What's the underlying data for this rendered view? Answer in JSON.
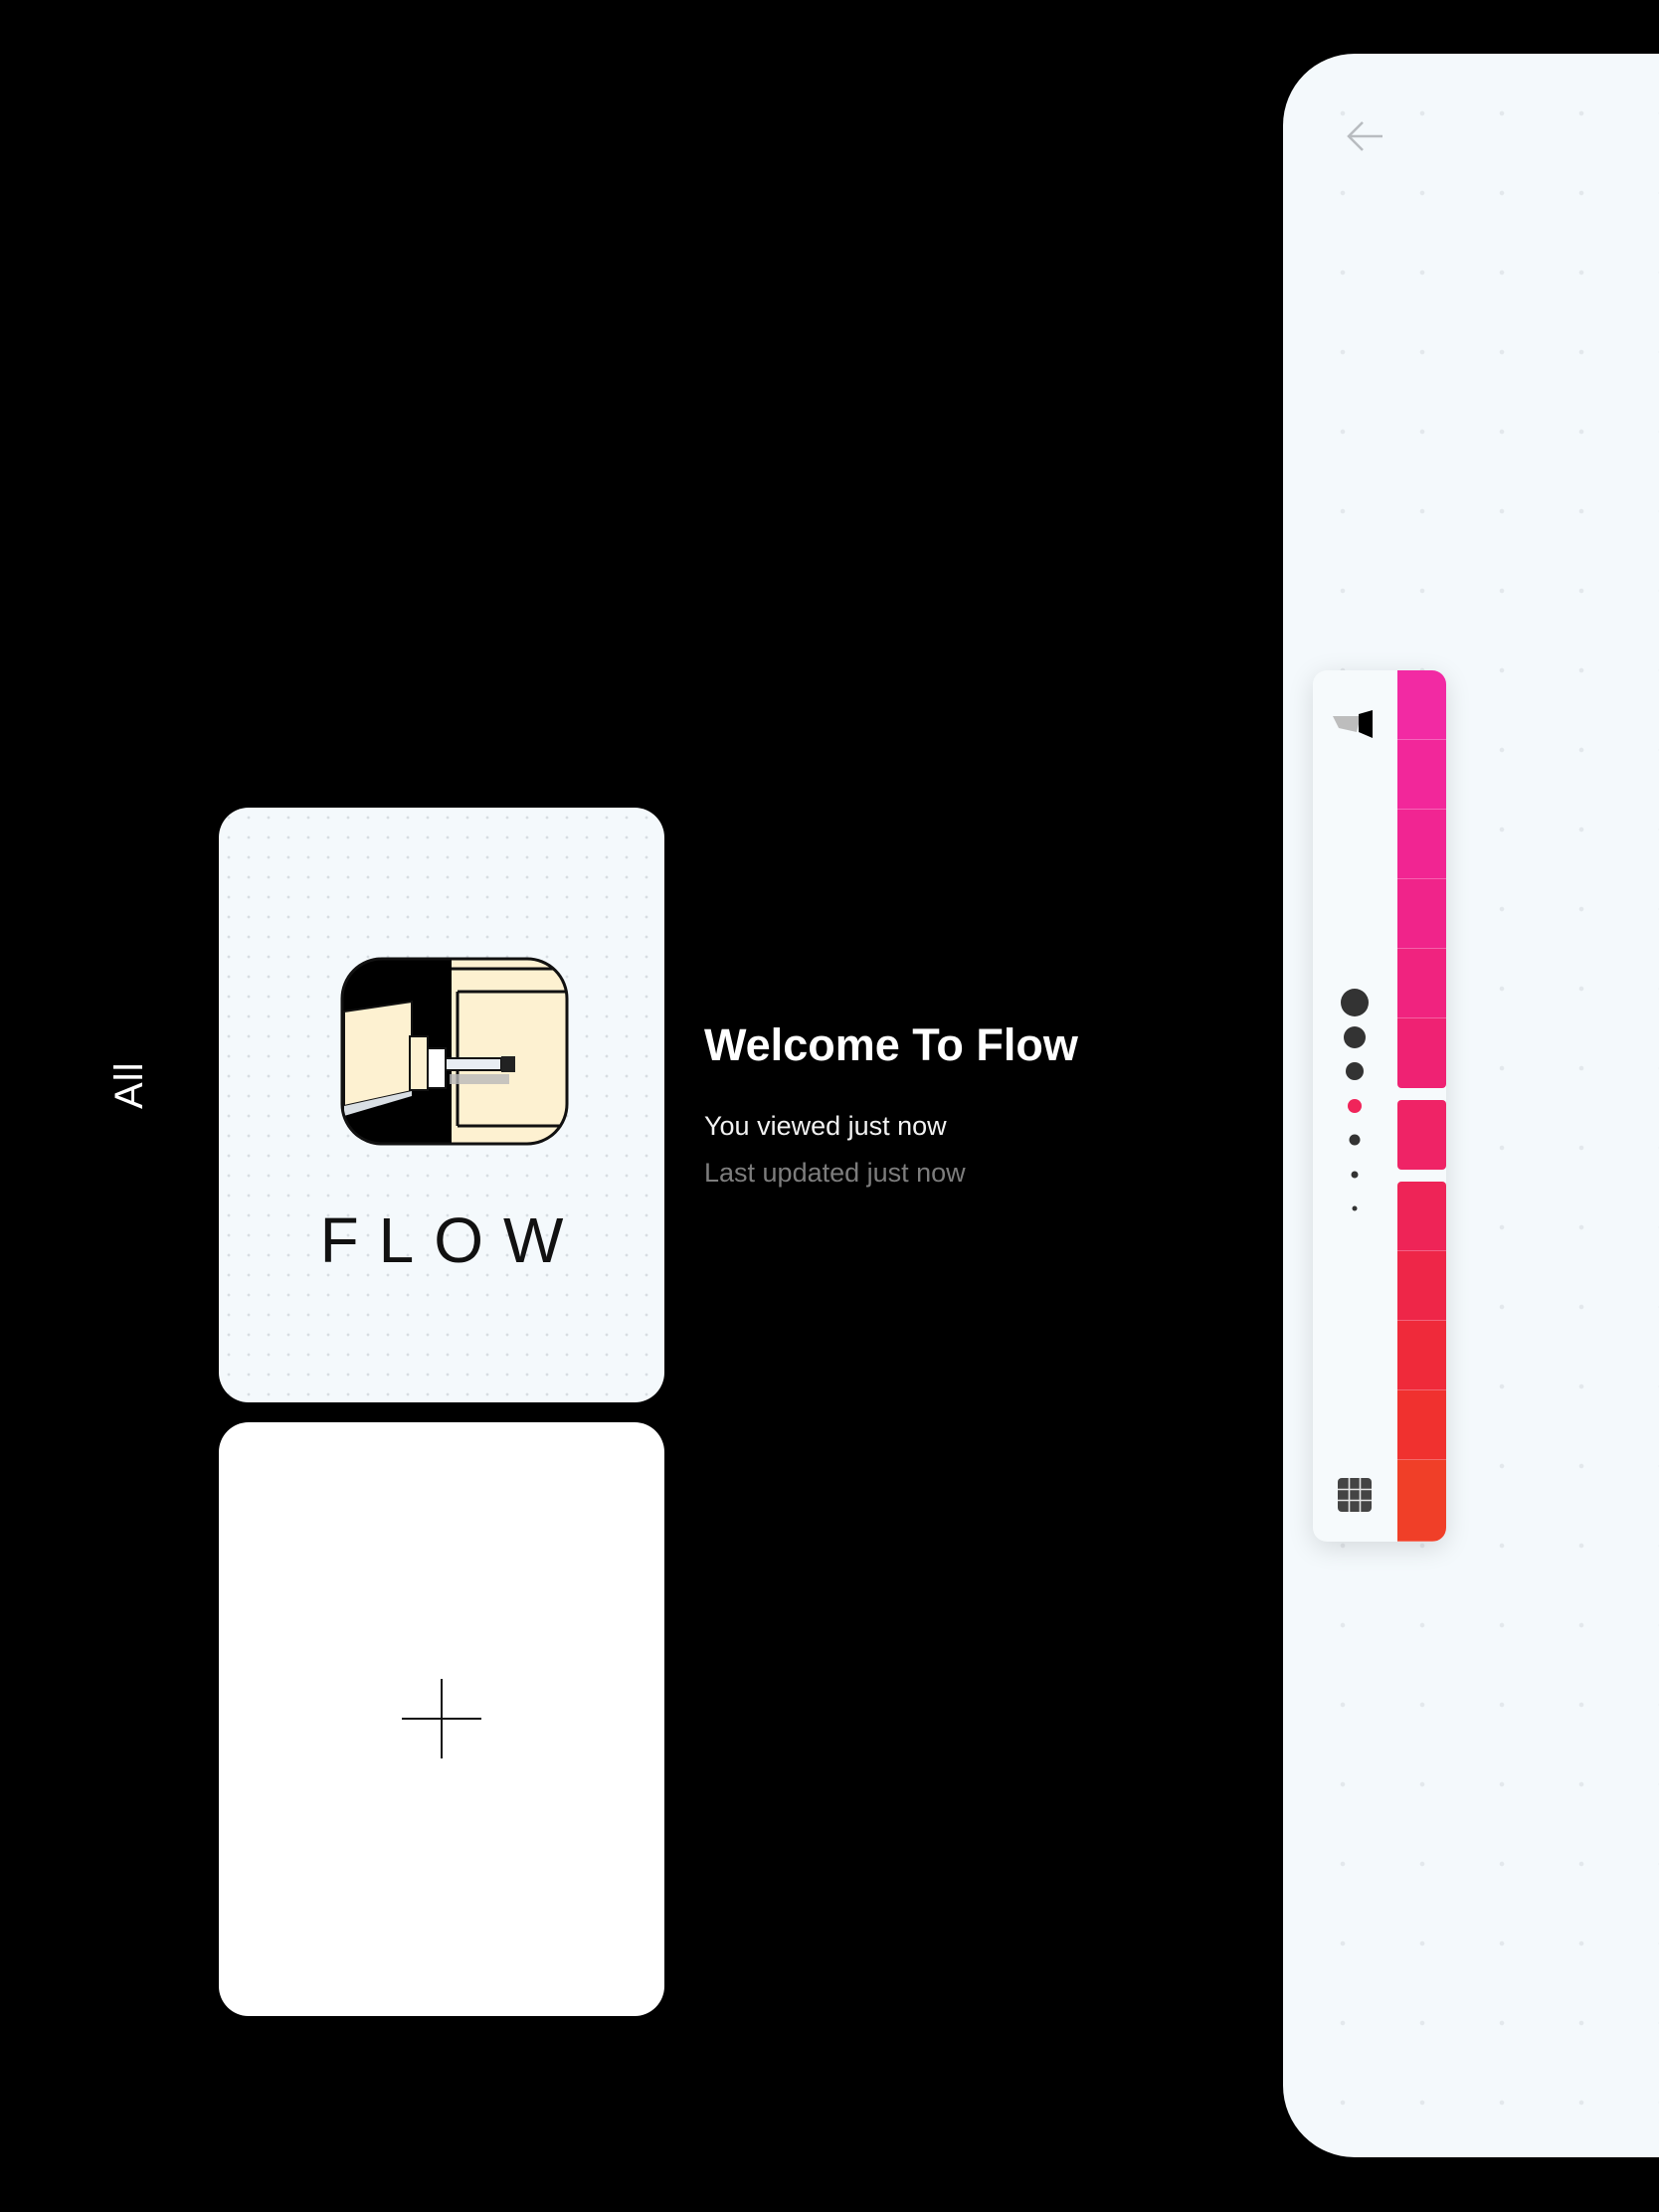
{
  "sidebar": {
    "category_label": "All"
  },
  "note": {
    "title": "Welcome To Flow",
    "viewed": "You viewed just now",
    "updated": "Last updated just now",
    "thumbnail_logo_text": "FLOW"
  },
  "new_note": {
    "icon": "plus-icon"
  },
  "editor": {
    "back_icon": "arrow-left-icon",
    "toolbar": {
      "tool_icon": "marker-icon",
      "grid_icon": "grid-icon",
      "brush_sizes": [
        {
          "name": "size-1",
          "selected": false
        },
        {
          "name": "size-2",
          "selected": false
        },
        {
          "name": "size-3",
          "selected": false
        },
        {
          "name": "size-4",
          "selected": true,
          "color": "#f0245a"
        },
        {
          "name": "size-5",
          "selected": false
        },
        {
          "name": "size-6",
          "selected": false
        },
        {
          "name": "size-7",
          "selected": false
        }
      ],
      "palette": [
        "#f22aa3",
        "#f2279a",
        "#f12592",
        "#f0248a",
        "#f0237f",
        "#ef2273",
        "#ef2366",
        "#ee2457",
        "#ee2648",
        "#ef2a3a",
        "#f0312f",
        "#f03f28"
      ],
      "selected_color_index": 6
    }
  },
  "colors": {
    "background": "#000000",
    "canvas": "#f4f9fc",
    "accent": "#f0245a"
  }
}
